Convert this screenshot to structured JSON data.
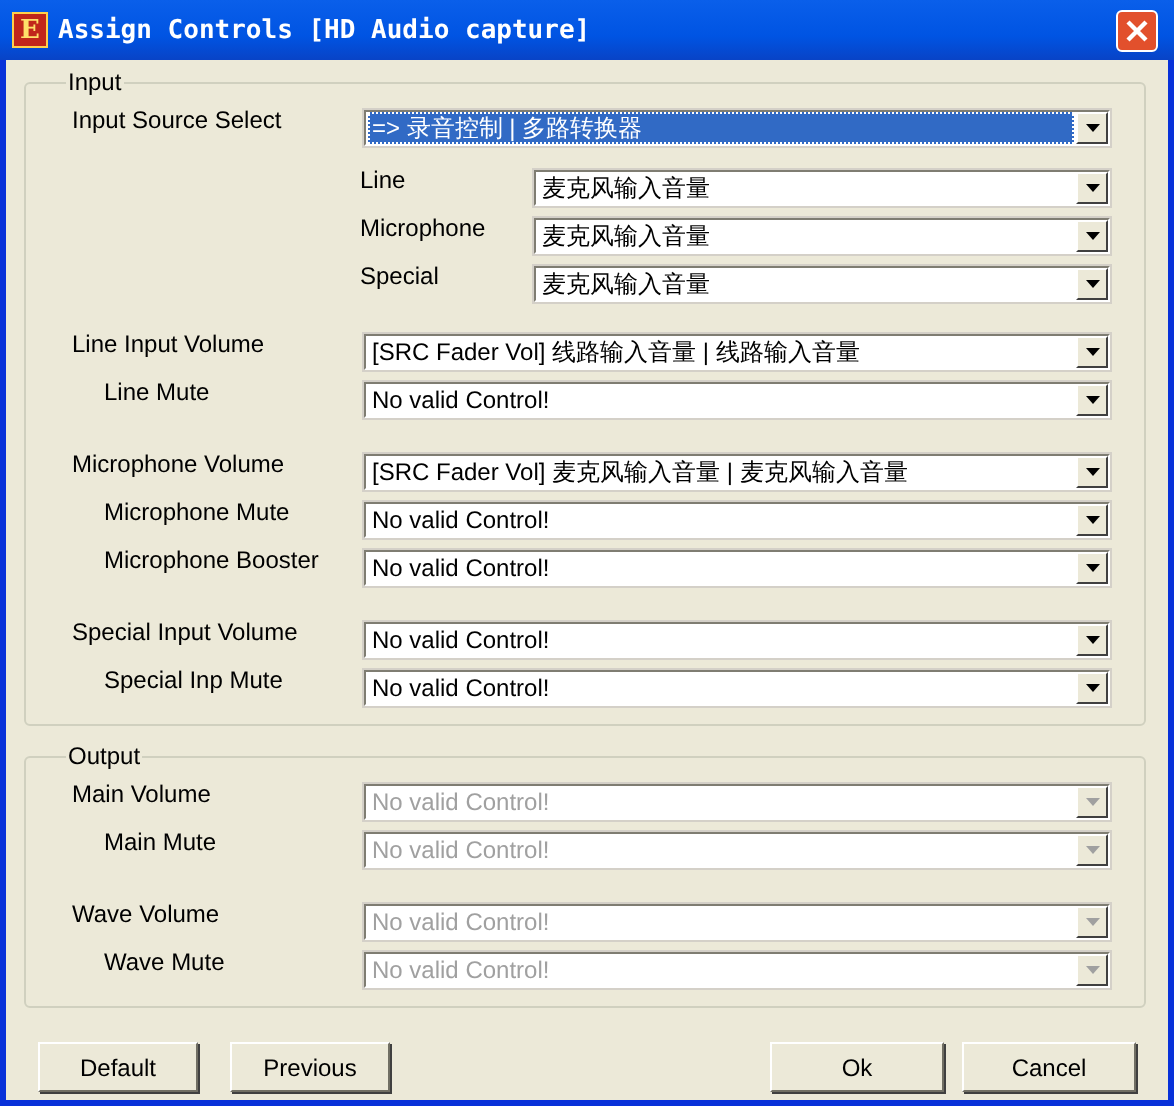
{
  "window": {
    "title": "Assign Controls [HD Audio capture]",
    "icon_letter": "E"
  },
  "input": {
    "label": "Input",
    "source_select": {
      "label": "Input Source Select",
      "value": "=> 录音控制 | 多路转换器",
      "selected": true,
      "disabled": false
    },
    "sources": [
      {
        "label": "Line",
        "value": "麦克风输入音量",
        "disabled": false
      },
      {
        "label": "Microphone",
        "value": "麦克风输入音量",
        "disabled": false
      },
      {
        "label": "Special",
        "value": "麦克风输入音量",
        "disabled": false
      }
    ],
    "groups": [
      {
        "rows": [
          {
            "kind": "main",
            "label": "Line Input Volume",
            "value": "[SRC Fader  Vol] 线路输入音量 | 线路输入音量",
            "disabled": false
          },
          {
            "kind": "sub",
            "label": "Line Mute",
            "value": "No valid Control!",
            "disabled": false
          }
        ]
      },
      {
        "rows": [
          {
            "kind": "main",
            "label": "Microphone Volume",
            "value": "[SRC Fader  Vol] 麦克风输入音量 | 麦克风输入音量",
            "disabled": false
          },
          {
            "kind": "sub",
            "label": "Microphone Mute",
            "value": "No valid Control!",
            "disabled": false
          },
          {
            "kind": "sub",
            "label": "Microphone Booster",
            "value": "No valid Control!",
            "disabled": false
          }
        ]
      },
      {
        "rows": [
          {
            "kind": "main",
            "label": "Special Input Volume",
            "value": "No valid Control!",
            "disabled": false
          },
          {
            "kind": "sub",
            "label": "Special Inp Mute",
            "value": "No valid Control!",
            "disabled": false
          }
        ]
      }
    ]
  },
  "output": {
    "label": "Output",
    "groups": [
      {
        "rows": [
          {
            "kind": "main",
            "label": "Main Volume",
            "value": "No valid Control!",
            "disabled": true
          },
          {
            "kind": "sub",
            "label": "Main Mute",
            "value": "No valid Control!",
            "disabled": true
          }
        ]
      },
      {
        "rows": [
          {
            "kind": "main",
            "label": "Wave Volume",
            "value": "No valid Control!",
            "disabled": true
          },
          {
            "kind": "sub",
            "label": "Wave Mute",
            "value": "No valid Control!",
            "disabled": true
          }
        ]
      }
    ]
  },
  "buttons_left": [
    {
      "label": "Default"
    },
    {
      "label": "Previous"
    }
  ],
  "buttons_right": [
    {
      "label": "Ok"
    },
    {
      "label": "Cancel"
    }
  ]
}
